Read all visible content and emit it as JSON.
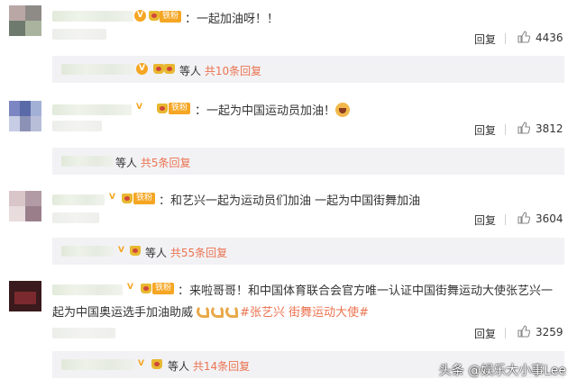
{
  "comments": [
    {
      "badge": "铁粉",
      "text": "：一起加油呀！！",
      "reply_label": "回复",
      "likes": "4436",
      "sub": {
        "who": "等人",
        "link": "共10条回复"
      }
    },
    {
      "badge": "铁粉",
      "text": "：一起为中国运动员加油！",
      "reply_label": "回复",
      "likes": "3812",
      "sub": {
        "who": "等人",
        "link": "共5条回复"
      }
    },
    {
      "badge": "铁粉",
      "text": "：和艺兴一起为运动员们加油 一起为中国街舞加油",
      "reply_label": "回复",
      "likes": "3604",
      "sub": {
        "who": "等人",
        "link": "共55条回复"
      }
    },
    {
      "badge": "铁粉",
      "text_line1": "：来啦哥哥！和中国体育联合会官方唯一认证中国街舞运动大使张艺兴一",
      "text_line2": "起为中国奥运选手加油助威",
      "hashtag": "#张艺兴 街舞运动大使#",
      "reply_label": "回复",
      "likes": "3259",
      "sub": {
        "who": "等人",
        "link": "共14条回复"
      }
    }
  ],
  "watermark": "头条 @娱乐大小事Lee",
  "colors": {
    "link": "#eb7350",
    "badge": "#f5a623",
    "subbox": "#f2f2f5"
  }
}
